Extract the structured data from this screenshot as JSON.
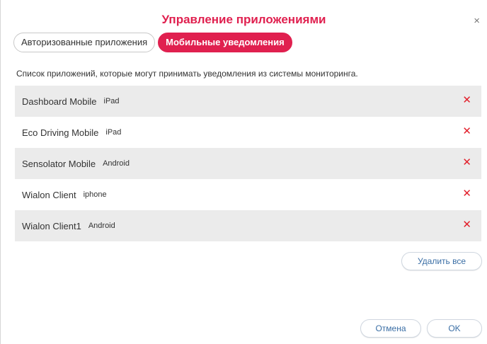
{
  "dialog": {
    "title": "Управление приложениями",
    "close_symbol": "×"
  },
  "tabs": [
    {
      "label": "Авторизованные приложения",
      "active": false
    },
    {
      "label": "Мобильные уведомления",
      "active": true
    }
  ],
  "description": "Список приложений, которые могут принимать уведомления из системы мониторинга.",
  "apps": [
    {
      "name": "Dashboard Mobile",
      "device": "iPad"
    },
    {
      "name": "Eco Driving Mobile",
      "device": "iPad"
    },
    {
      "name": "Sensolator Mobile",
      "device": "Android"
    },
    {
      "name": "Wialon Client",
      "device": "iphone"
    },
    {
      "name": "Wialon Client1",
      "device": "Android"
    }
  ],
  "delete_symbol": "✕",
  "buttons": {
    "delete_all": "Удалить все",
    "cancel": "Отмена",
    "ok": "OK"
  },
  "colors": {
    "accent": "#e0204f",
    "delete_icon": "#e21f2b",
    "button_text": "#3a6ea5",
    "row_alt": "#ebebeb"
  },
  "icons": {
    "close": "close-icon",
    "delete": "delete-x-icon"
  }
}
